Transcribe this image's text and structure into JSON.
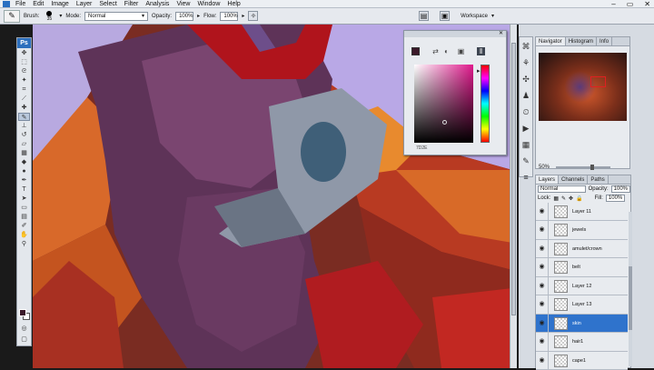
{
  "menubar": {
    "items": [
      "File",
      "Edit",
      "Image",
      "Layer",
      "Select",
      "Filter",
      "Analysis",
      "View",
      "Window",
      "Help"
    ],
    "window_controls": [
      "–",
      "▭",
      "✕"
    ]
  },
  "options_bar": {
    "brush_label": "Brush:",
    "brush_size": "35",
    "mode_label": "Mode:",
    "mode_value": "Normal",
    "opacity_label": "Opacity:",
    "opacity_value": "100%",
    "flow_label": "Flow:",
    "flow_value": "100%",
    "workspace_label": "Workspace"
  },
  "toolbox": {
    "logo": "Ps",
    "foreground_color": "#3b1a2a",
    "background_color": "#ffffff"
  },
  "color_picker": {
    "current_color": "#3b1a2a",
    "hex_value": "7D2E",
    "hue_color": "#e0198c"
  },
  "navigator": {
    "tabs": [
      "Navigator",
      "Histogram",
      "Info"
    ],
    "zoom": "50%"
  },
  "layers": {
    "tabs": [
      "Layers",
      "Channels",
      "Paths"
    ],
    "blend_mode": "Normal",
    "opacity_label": "Opacity:",
    "opacity_value": "100%",
    "lock_label": "Lock:",
    "fill_label": "Fill:",
    "fill_value": "100%",
    "items": [
      {
        "name": "Layer 11",
        "selected": false
      },
      {
        "name": "jewels",
        "selected": false
      },
      {
        "name": "amulet/crown",
        "selected": false
      },
      {
        "name": "belt",
        "selected": false
      },
      {
        "name": "Layer 12",
        "selected": false
      },
      {
        "name": "Layer 13",
        "selected": false
      },
      {
        "name": "skin",
        "selected": true
      },
      {
        "name": "hair1",
        "selected": false
      },
      {
        "name": "cape1",
        "selected": false
      }
    ]
  }
}
